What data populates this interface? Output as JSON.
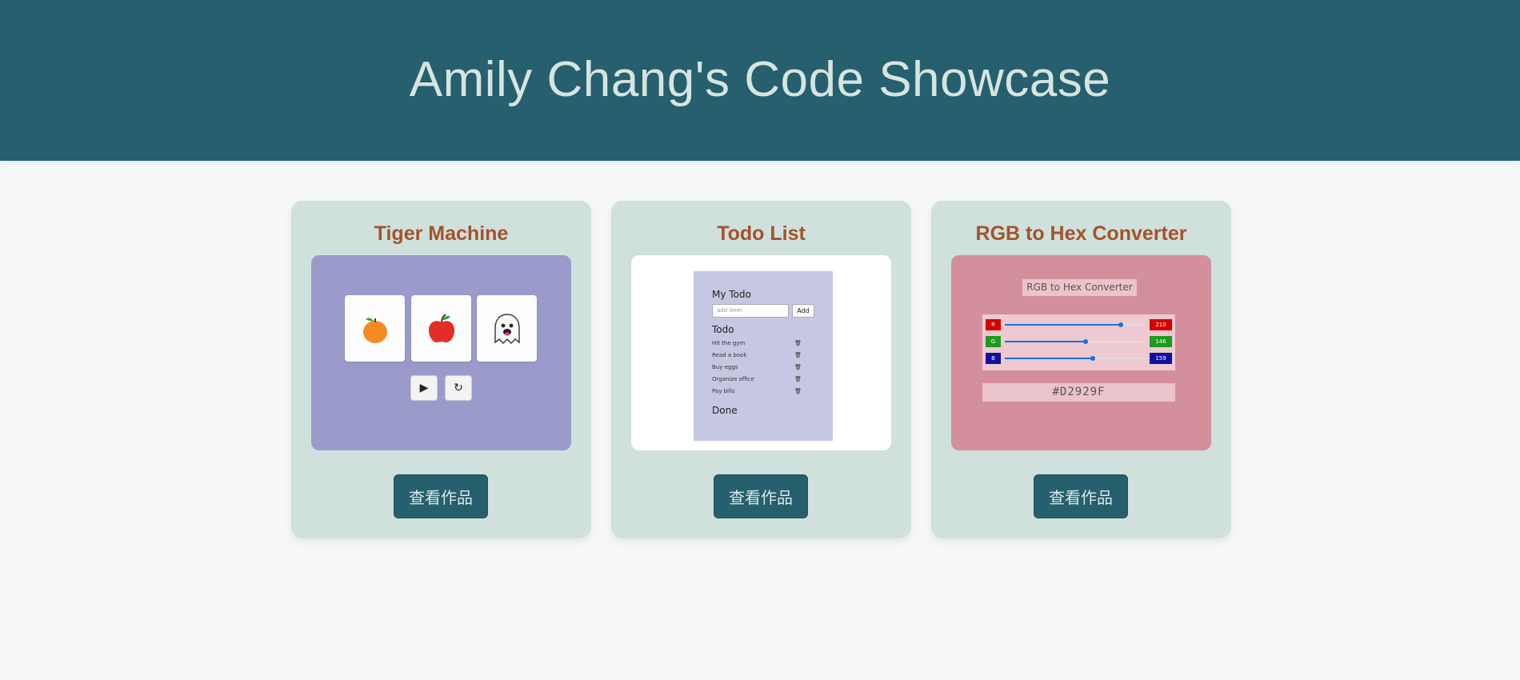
{
  "header": {
    "title": "Amily Chang's Code Showcase"
  },
  "colors": {
    "header_bg": "#265f6e",
    "card_bg": "#d0e0dc",
    "title_color": "#a3532b",
    "button_bg": "#265f6e"
  },
  "cards": [
    {
      "title": "Tiger Machine",
      "button_label": "查看作品",
      "preview": {
        "reels": [
          "orange-icon",
          "apple-icon",
          "ghost-icon"
        ],
        "controls": [
          {
            "name": "play-icon",
            "glyph": "▶"
          },
          {
            "name": "restart-icon",
            "glyph": "↻"
          }
        ]
      }
    },
    {
      "title": "Todo List",
      "button_label": "查看作品",
      "preview": {
        "app_title": "My Todo",
        "input_placeholder": "add item",
        "add_label": "Add",
        "todo_heading": "Todo",
        "items": [
          "Hit the gym",
          "Read a book",
          "Buy eggs",
          "Organize office",
          "Pay bills"
        ],
        "done_heading": "Done",
        "trash_icon": "trash-icon"
      }
    },
    {
      "title": "RGB to Hex Converter",
      "button_label": "查看作品",
      "preview": {
        "app_title": "RGB to Hex Converter",
        "channels": [
          {
            "label": "R",
            "value": "210",
            "color": "#d40000"
          },
          {
            "label": "G",
            "value": "146",
            "color": "#1f9a1f"
          },
          {
            "label": "B",
            "value": "159",
            "color": "#1010a0"
          }
        ],
        "hex": "#D2929F"
      }
    }
  ]
}
